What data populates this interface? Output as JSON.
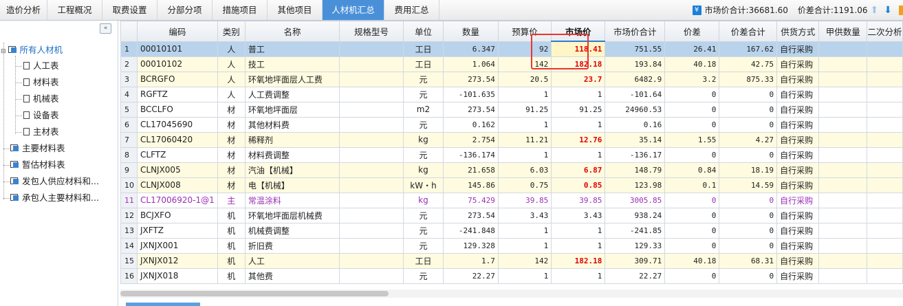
{
  "tabs": [
    {
      "label": "造价分析"
    },
    {
      "label": "工程概况"
    },
    {
      "label": "取费设置"
    },
    {
      "label": "分部分项"
    },
    {
      "label": "措施项目"
    },
    {
      "label": "其他项目"
    },
    {
      "label": "人材机汇总"
    },
    {
      "label": "费用汇总"
    }
  ],
  "summary": {
    "market_total_label": "市场价合计:36681.60",
    "diff_total_label": "价差合计:1191.06"
  },
  "sidebar": {
    "collapse_icon": "«",
    "items": [
      {
        "label": "所有人材机"
      },
      {
        "label": "人工表"
      },
      {
        "label": "材料表"
      },
      {
        "label": "机械表"
      },
      {
        "label": "设备表"
      },
      {
        "label": "主材表"
      },
      {
        "label": "主要材料表"
      },
      {
        "label": "暂估材料表"
      },
      {
        "label": "发包人供应材料和..."
      },
      {
        "label": "承包人主要材料和..."
      }
    ]
  },
  "columns": [
    "编码",
    "类别",
    "名称",
    "规格型号",
    "单位",
    "数量",
    "预算价",
    "市场价",
    "市场价合计",
    "价差",
    "价差合计",
    "供货方式",
    "甲供数量",
    "二次分析"
  ],
  "rows": [
    {
      "no": "1",
      "code": "00010101",
      "type": "人",
      "name": "普工",
      "spec": "",
      "unit": "工日",
      "qty": "6.347",
      "budget": "92",
      "market": "118.41",
      "mtotal": "751.55",
      "diff": "26.41",
      "dtotal": "167.62",
      "supply": "自行采购",
      "jqty": "",
      "sec": ""
    },
    {
      "no": "2",
      "code": "00010102",
      "type": "人",
      "name": "技工",
      "spec": "",
      "unit": "工日",
      "qty": "1.064",
      "budget": "142",
      "market": "182.18",
      "mtotal": "193.84",
      "diff": "40.18",
      "dtotal": "42.75",
      "supply": "自行采购",
      "jqty": "",
      "sec": ""
    },
    {
      "no": "3",
      "code": "BCRGFO",
      "type": "人",
      "name": "环氧地坪面层人工费",
      "spec": "",
      "unit": "元",
      "qty": "273.54",
      "budget": "20.5",
      "market": "23.7",
      "mtotal": "6482.9",
      "diff": "3.2",
      "dtotal": "875.33",
      "supply": "自行采购",
      "jqty": "",
      "sec": ""
    },
    {
      "no": "4",
      "code": "RGFTZ",
      "type": "人",
      "name": "人工费调整",
      "spec": "",
      "unit": "元",
      "qty": "-101.635",
      "budget": "1",
      "market": "1",
      "mtotal": "-101.64",
      "diff": "0",
      "dtotal": "0",
      "supply": "自行采购",
      "jqty": "",
      "sec": ""
    },
    {
      "no": "5",
      "code": "BCCLFO",
      "type": "材",
      "name": "环氧地坪面层",
      "spec": "",
      "unit": "m2",
      "qty": "273.54",
      "budget": "91.25",
      "market": "91.25",
      "mtotal": "24960.53",
      "diff": "0",
      "dtotal": "0",
      "supply": "自行采购",
      "jqty": "",
      "sec": ""
    },
    {
      "no": "6",
      "code": "CL17045690",
      "type": "材",
      "name": "其他材料费",
      "spec": "",
      "unit": "元",
      "qty": "0.162",
      "budget": "1",
      "market": "1",
      "mtotal": "0.16",
      "diff": "0",
      "dtotal": "0",
      "supply": "自行采购",
      "jqty": "",
      "sec": ""
    },
    {
      "no": "7",
      "code": "CL17060420",
      "type": "材",
      "name": "稀释剂",
      "spec": "",
      "unit": "kg",
      "qty": "2.754",
      "budget": "11.21",
      "market": "12.76",
      "mtotal": "35.14",
      "diff": "1.55",
      "dtotal": "4.27",
      "supply": "自行采购",
      "jqty": "",
      "sec": ""
    },
    {
      "no": "8",
      "code": "CLFTZ",
      "type": "材",
      "name": "材料费调整",
      "spec": "",
      "unit": "元",
      "qty": "-136.174",
      "budget": "1",
      "market": "1",
      "mtotal": "-136.17",
      "diff": "0",
      "dtotal": "0",
      "supply": "自行采购",
      "jqty": "",
      "sec": ""
    },
    {
      "no": "9",
      "code": "CLNJX005",
      "type": "材",
      "name": "汽油【机械】",
      "spec": "",
      "unit": "kg",
      "qty": "21.658",
      "budget": "6.03",
      "market": "6.87",
      "mtotal": "148.79",
      "diff": "0.84",
      "dtotal": "18.19",
      "supply": "自行采购",
      "jqty": "",
      "sec": ""
    },
    {
      "no": "10",
      "code": "CLNJX008",
      "type": "材",
      "name": "电【机械】",
      "spec": "",
      "unit": "kW・h",
      "qty": "145.86",
      "budget": "0.75",
      "market": "0.85",
      "mtotal": "123.98",
      "diff": "0.1",
      "dtotal": "14.59",
      "supply": "自行采购",
      "jqty": "",
      "sec": ""
    },
    {
      "no": "11",
      "code": "CL17006920-1@1",
      "type": "主",
      "name": "常温涂料",
      "spec": "",
      "unit": "kg",
      "qty": "75.429",
      "budget": "39.85",
      "market": "39.85",
      "mtotal": "3005.85",
      "diff": "0",
      "dtotal": "0",
      "supply": "自行采购",
      "jqty": "",
      "sec": ""
    },
    {
      "no": "12",
      "code": "BCJXFO",
      "type": "机",
      "name": "环氧地坪面层机械费",
      "spec": "",
      "unit": "元",
      "qty": "273.54",
      "budget": "3.43",
      "market": "3.43",
      "mtotal": "938.24",
      "diff": "0",
      "dtotal": "0",
      "supply": "自行采购",
      "jqty": "",
      "sec": ""
    },
    {
      "no": "13",
      "code": "JXFTZ",
      "type": "机",
      "name": "机械费调整",
      "spec": "",
      "unit": "元",
      "qty": "-241.848",
      "budget": "1",
      "market": "1",
      "mtotal": "-241.85",
      "diff": "0",
      "dtotal": "0",
      "supply": "自行采购",
      "jqty": "",
      "sec": ""
    },
    {
      "no": "14",
      "code": "JXNJX001",
      "type": "机",
      "name": "折旧费",
      "spec": "",
      "unit": "元",
      "qty": "129.328",
      "budget": "1",
      "market": "1",
      "mtotal": "129.33",
      "diff": "0",
      "dtotal": "0",
      "supply": "自行采购",
      "jqty": "",
      "sec": ""
    },
    {
      "no": "15",
      "code": "JXNJX012",
      "type": "机",
      "name": "人工",
      "spec": "",
      "unit": "工日",
      "qty": "1.7",
      "budget": "142",
      "market": "182.18",
      "mtotal": "309.71",
      "diff": "40.18",
      "dtotal": "68.31",
      "supply": "自行采购",
      "jqty": "",
      "sec": ""
    },
    {
      "no": "16",
      "code": "JXNJX018",
      "type": "机",
      "name": "其他费",
      "spec": "",
      "unit": "元",
      "qty": "22.27",
      "budget": "1",
      "market": "1",
      "mtotal": "22.27",
      "diff": "0",
      "dtotal": "0",
      "supply": "自行采购",
      "jqty": "",
      "sec": ""
    }
  ]
}
